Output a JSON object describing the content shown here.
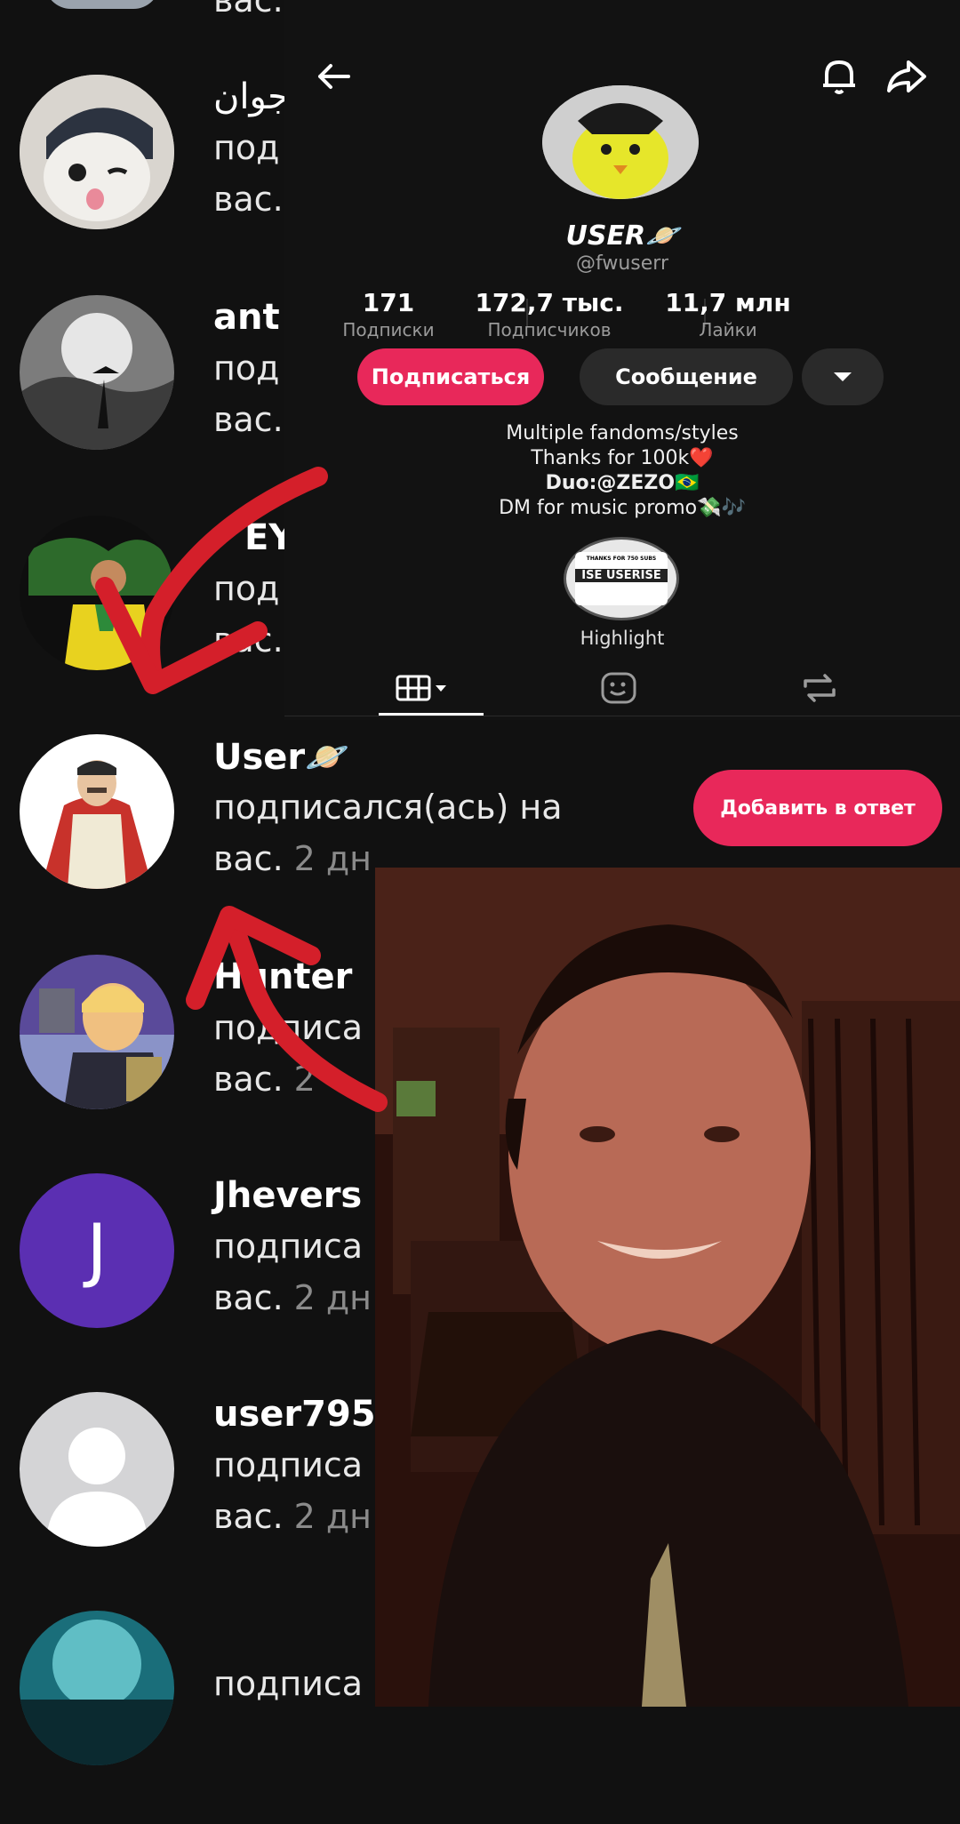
{
  "notifications": [
    {
      "name": "جوان",
      "line1": "под",
      "line2": "вас.",
      "time": ""
    },
    {
      "name": "ant",
      "line1": "под",
      "line2": "вас.",
      "time": ""
    },
    {
      "name": "EY",
      "line1": "под",
      "line2": "вас.",
      "time": ""
    },
    {
      "name": "User🪐",
      "line1": "подписался(ась) на",
      "line2": "вас.",
      "time": "2 дн"
    },
    {
      "name": "Hunter",
      "line1": "подписа",
      "line2": "вас.",
      "time": "2"
    },
    {
      "name": "Jhevers",
      "line1": "подписа",
      "line2": "вас.",
      "time": "2 дн"
    },
    {
      "name": "user795",
      "line1": "подписа",
      "line2": "вас.",
      "time": "2 дн"
    },
    {
      "name": "",
      "line1": "подписа",
      "line2": "",
      "time": ""
    }
  ],
  "avatar_letter": "J",
  "profile": {
    "username": "USER🪐",
    "handle": "@fwuserr",
    "stats": [
      {
        "value": "171",
        "label": "Подписки"
      },
      {
        "value": "172,7 тыс.",
        "label": "Подписчиков"
      },
      {
        "value": "11,7 млн",
        "label": "Лайки"
      }
    ],
    "follow_label": "Подписаться",
    "message_label": "Сообщение",
    "bio": [
      "Multiple fandoms/styles",
      "Thanks for 100k❤️",
      "Duo:@ZEZO🇧🇷",
      "DM for music promo💸🎶"
    ],
    "highlight_label": "Highlight",
    "highlight_text_top": "THANKS FOR 750 SUBS",
    "highlight_text_bottom": "ISE USERISE"
  },
  "add_reply_label": "Добавить в ответ",
  "colors": {
    "accent": "#e8285a",
    "arrow": "#d41f2a",
    "button_dark": "#2a2a2a",
    "background": "#111111"
  }
}
